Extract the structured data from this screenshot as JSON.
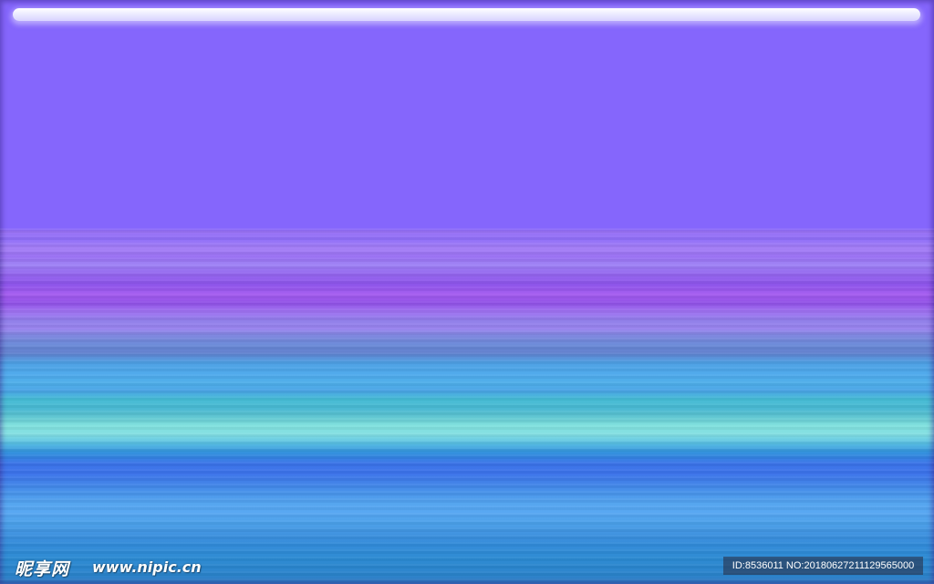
{
  "watermark": {
    "logo_text": "昵享网",
    "url_text": "www.nipic.cn",
    "id_text": "ID:8536011 NO:20180627211129565000"
  },
  "colors": {
    "top_purple": "#8566fc",
    "mid_violet": "#9050e6",
    "cyan_band": "#83dfe3",
    "bottom_blue": "#2a7fc6"
  }
}
